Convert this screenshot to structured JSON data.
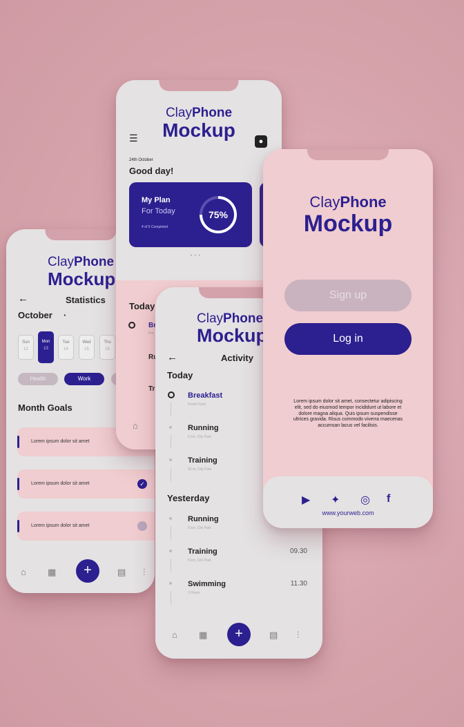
{
  "brand": {
    "line1_light": "Clay",
    "line1_bold": "Phone",
    "line2": "Mockup"
  },
  "statistics_screen": {
    "back": "←",
    "title": "Statistics",
    "month": "October",
    "month_caret": "·",
    "days": [
      {
        "name": "Sun",
        "num": "12"
      },
      {
        "name": "Mon",
        "num": "13"
      },
      {
        "name": "Tue",
        "num": "14"
      },
      {
        "name": "Wed",
        "num": "15"
      },
      {
        "name": "Thu",
        "num": "16"
      }
    ],
    "filters": [
      "Health",
      "Work"
    ],
    "goals_title": "Month Goals",
    "goals": [
      {
        "text": "Lorem ipsum dolor sit amet"
      },
      {
        "text": "Lorem ipsum dolor sit amet"
      },
      {
        "text": "Lorem ipsum dolor sit amet"
      }
    ],
    "fab": "+"
  },
  "home_screen": {
    "date": "24th October",
    "greeting": "Good day!",
    "plan_title": "My Plan",
    "plan_subtitle": "For Today",
    "plan_progress": "4 of 5 Completed",
    "progress_percent": "75%",
    "progress_value": 0.75,
    "dots": "• • •",
    "today_label": "Today",
    "peek_items": [
      {
        "initial": "Br",
        "sub": "Fre"
      },
      {
        "initial": "Ru",
        "sub": ""
      },
      {
        "initial": "Tr",
        "sub": ""
      }
    ]
  },
  "activity_screen": {
    "back": "←",
    "title": "Activity",
    "today_label": "Today",
    "today_items": [
      {
        "title": "Breakfast",
        "sub": "Fresh Food",
        "time": ""
      },
      {
        "title": "Running",
        "sub": "5 km, City Park",
        "time": ""
      },
      {
        "title": "Training",
        "sub": "25 m, City Park",
        "time": ""
      }
    ],
    "yesterday_label": "Yesterday",
    "yesterday_items": [
      {
        "title": "Running",
        "sub": "5 km, City Park",
        "time": ""
      },
      {
        "title": "Training",
        "sub": "5 km, City Park",
        "time": "09.30"
      },
      {
        "title": "Swimming",
        "sub": "2 Hours",
        "time": "11.30"
      }
    ],
    "fab": "+"
  },
  "login_screen": {
    "signup_label": "Sign up",
    "login_label": "Log in",
    "body_text": "Lorem ipsum dolor sit amet, consectetur adipiscing elit, sed do eiusmod tempor incididunt ut labore et dolore magna aliqua. Quis ipsum suspendisse ultrices gravida. Risus commodo viverra maecenas accumsan lacus vel facilisis.",
    "website": "www.yourweb.com"
  },
  "colors": {
    "navy": "#2c1f8f",
    "pink": "#f0cdd0",
    "gray": "#e4e2e3",
    "background": "#d6a4ac"
  }
}
